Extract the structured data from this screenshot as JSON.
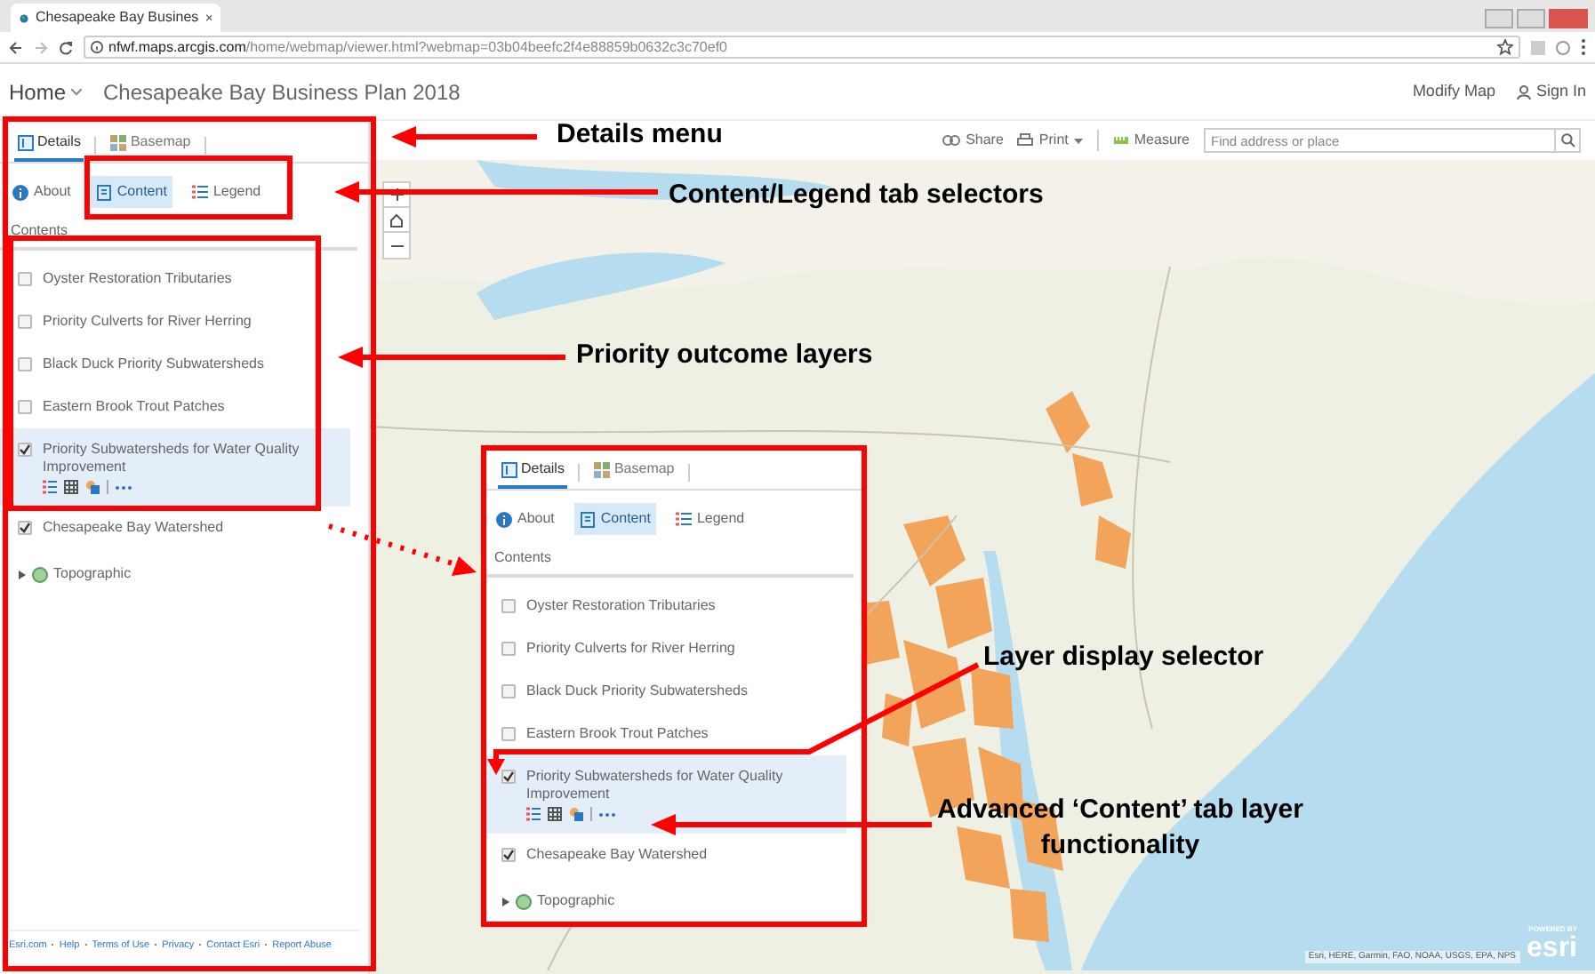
{
  "browser": {
    "tab_title": "Chesapeake Bay Busines",
    "url_host": "nfwf.maps.arcgis.com",
    "url_path": "/home/webmap/viewer.html?webmap=03b04beefc2f4e88859b0632c3c70ef0"
  },
  "header": {
    "home": "Home",
    "title": "Chesapeake Bay Business Plan 2018",
    "modify": "Modify Map",
    "sign_in": "Sign In"
  },
  "toolbar": {
    "items": [
      {
        "kind": "share",
        "label": "Share"
      },
      {
        "kind": "print",
        "label": "Print"
      },
      {
        "kind": "measure",
        "label": "Measure"
      }
    ],
    "search": {
      "placeholder": "Find address or place"
    }
  },
  "panel": {
    "tabs": [
      {
        "label": "Details",
        "selected": true
      },
      {
        "label": "Basemap",
        "selected": false
      }
    ],
    "views": [
      {
        "kind": "about",
        "label": "About",
        "selected": false
      },
      {
        "kind": "content",
        "label": "Content",
        "selected": true
      },
      {
        "kind": "legend",
        "label": "Legend",
        "selected": false
      }
    ],
    "heading": "Contents",
    "layers": [
      {
        "label": "Oyster Restoration Tributaries",
        "checked": false,
        "selected": false
      },
      {
        "label": "Priority Culverts for River Herring",
        "checked": false,
        "selected": false
      },
      {
        "label": "Black Duck Priority Subwatersheds",
        "checked": false,
        "selected": false
      },
      {
        "label": "Eastern Brook Trout Patches",
        "checked": false,
        "selected": false
      },
      {
        "label": "Priority Subwatersheds for Water Quality Improvement",
        "checked": true,
        "selected": true
      },
      {
        "label": "Chesapeake Bay Watershed",
        "checked": true,
        "selected": false
      }
    ],
    "basemap": {
      "label": "Topographic",
      "expanded": false
    },
    "footer_links": [
      "Esri.com",
      "Help",
      "Terms of Use",
      "Privacy",
      "Contact Esri",
      "Report Abuse"
    ]
  },
  "inset_panel": {
    "tabs": [
      {
        "label": "Details",
        "selected": true
      },
      {
        "label": "Basemap",
        "selected": false
      }
    ],
    "views": [
      {
        "kind": "about",
        "label": "About",
        "selected": false
      },
      {
        "kind": "content",
        "label": "Content",
        "selected": true
      },
      {
        "kind": "legend",
        "label": "Legend",
        "selected": false
      }
    ],
    "heading": "Contents",
    "layers": [
      {
        "label": "Oyster Restoration Tributaries",
        "checked": false,
        "selected": false
      },
      {
        "label": "Priority Culverts for River Herring",
        "checked": false,
        "selected": false
      },
      {
        "label": "Black Duck Priority Subwatersheds",
        "checked": false,
        "selected": false
      },
      {
        "label": "Eastern Brook Trout Patches",
        "checked": false,
        "selected": false
      },
      {
        "label": "Priority Subwatersheds for Water Quality Improvement",
        "checked": true,
        "selected": true
      },
      {
        "label": "Chesapeake Bay Watershed",
        "checked": true,
        "selected": false
      }
    ],
    "basemap": {
      "label": "Topographic",
      "expanded": false
    }
  },
  "map": {
    "attribution": "Esri, HERE, Garmin, FAO, NOAA, USGS, EPA, NPS",
    "logo_caption": "POWERED BY",
    "logo": "esri"
  },
  "annotations": [
    {
      "text": "Details menu"
    },
    {
      "text": "Content/Legend tab selectors"
    },
    {
      "text": "Priority outcome layers"
    },
    {
      "text": "Layer display selector"
    },
    {
      "text": "Advanced ‘Content’ tab layer functionality"
    }
  ]
}
